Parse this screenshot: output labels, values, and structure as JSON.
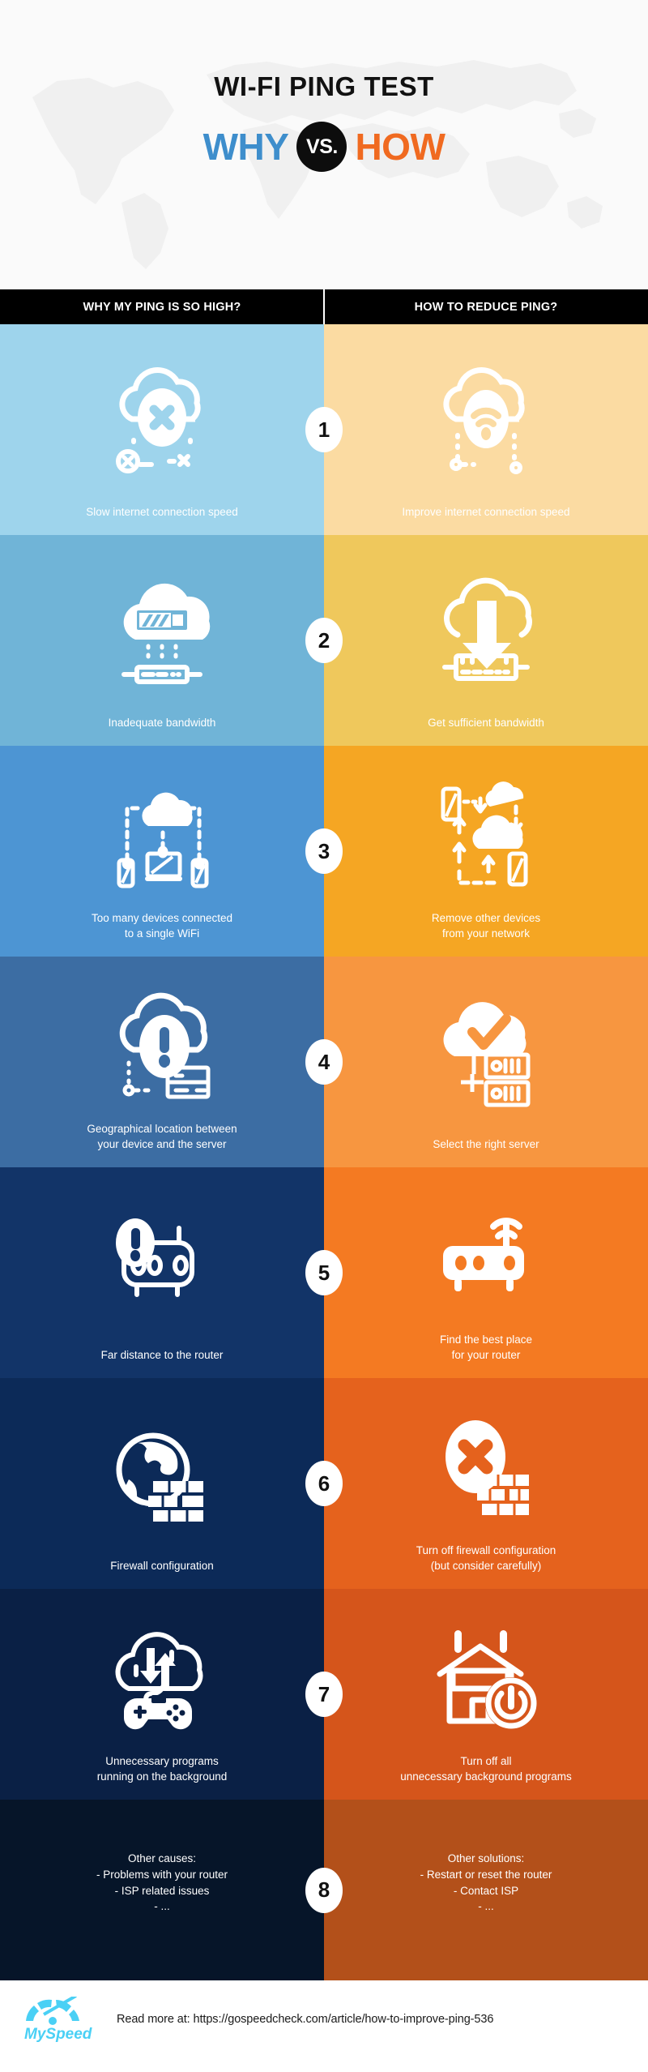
{
  "header": {
    "main_title": "WI-FI PING TEST",
    "why_word": "WHY",
    "vs_word": "VS.",
    "how_word": "HOW",
    "why_color": "#3e8ecc",
    "how_color": "#f06a20",
    "vs_circle_color": "#000000",
    "background": "#fafafa"
  },
  "columns": {
    "left_header": "WHY MY PING IS SO HIGH?",
    "right_header": "HOW TO REDUCE PING?",
    "header_bar_color": "#000000",
    "header_text_color": "#ffffff"
  },
  "rows": [
    {
      "number": "1",
      "left": {
        "caption": "Slow internet connection speed",
        "bg": "#9ed4ec",
        "icon": "cloud-x-error-icon"
      },
      "right": {
        "caption": "Improve internet connection speed",
        "bg": "#fbdba2",
        "icon": "cloud-wifi-signal-icon"
      }
    },
    {
      "number": "2",
      "left": {
        "caption": "Inadequate bandwidth",
        "bg": "#70b4d7",
        "icon": "cloud-low-bandwidth-gauge-icon"
      },
      "right": {
        "caption": "Get sufficient bandwidth",
        "bg": "#efc85c",
        "icon": "cloud-download-arrow-router-icon"
      }
    },
    {
      "number": "3",
      "left": {
        "caption": "Too many devices connected\nto a single WiFi",
        "bg": "#4d95d3",
        "icon": "many-devices-one-cloud-icon"
      },
      "right": {
        "caption": "Remove other devices\nfrom your network",
        "bg": "#f5a623",
        "icon": "devices-disconnect-arrows-icon"
      }
    },
    {
      "number": "4",
      "left": {
        "caption": "Geographical location between\nyour device and the server",
        "bg": "#3c6da3",
        "icon": "cloud-warning-server-distance-icon"
      },
      "right": {
        "caption": "Select the right server",
        "bg": "#f79640",
        "icon": "cloud-check-server-icon"
      }
    },
    {
      "number": "5",
      "left": {
        "caption": "Far distance to the router",
        "bg": "#123468",
        "icon": "router-warning-icon"
      },
      "right": {
        "caption": "Find the best place\nfor your router",
        "bg": "#f47a22",
        "icon": "router-wifi-signal-icon"
      }
    },
    {
      "number": "6",
      "left": {
        "caption": "Firewall configuration",
        "bg": "#0c2a58",
        "icon": "globe-firewall-icon"
      },
      "right": {
        "caption": "Turn off firewall configuration\n(but consider carefully)",
        "bg": "#e5621d",
        "icon": "firewall-disabled-x-icon"
      }
    },
    {
      "number": "7",
      "left": {
        "caption": "Unnecessary programs\nrunning on the background",
        "bg": "#0a2045",
        "icon": "cloud-gamepad-background-apps-icon"
      },
      "right": {
        "caption": "Turn off all\nunnecessary background programs",
        "bg": "#d5551b",
        "icon": "house-power-off-icon"
      }
    },
    {
      "number": "8",
      "left": {
        "caption": "Other causes:\n- Problems with your router\n- ISP related issues\n- ...",
        "bg": "#061529",
        "icon": ""
      },
      "right": {
        "caption": "Other solutions:\n- Restart or reset the router\n- Contact ISP\n- ...",
        "bg": "#b3501a",
        "icon": ""
      }
    }
  ],
  "footer": {
    "logo_text": "MySpeed",
    "logo_color": "#4ad0f5",
    "read_more": "Read more at: https://gospeedcheck.com/article/how-to-improve-ping-536",
    "background": "#ffffff"
  }
}
